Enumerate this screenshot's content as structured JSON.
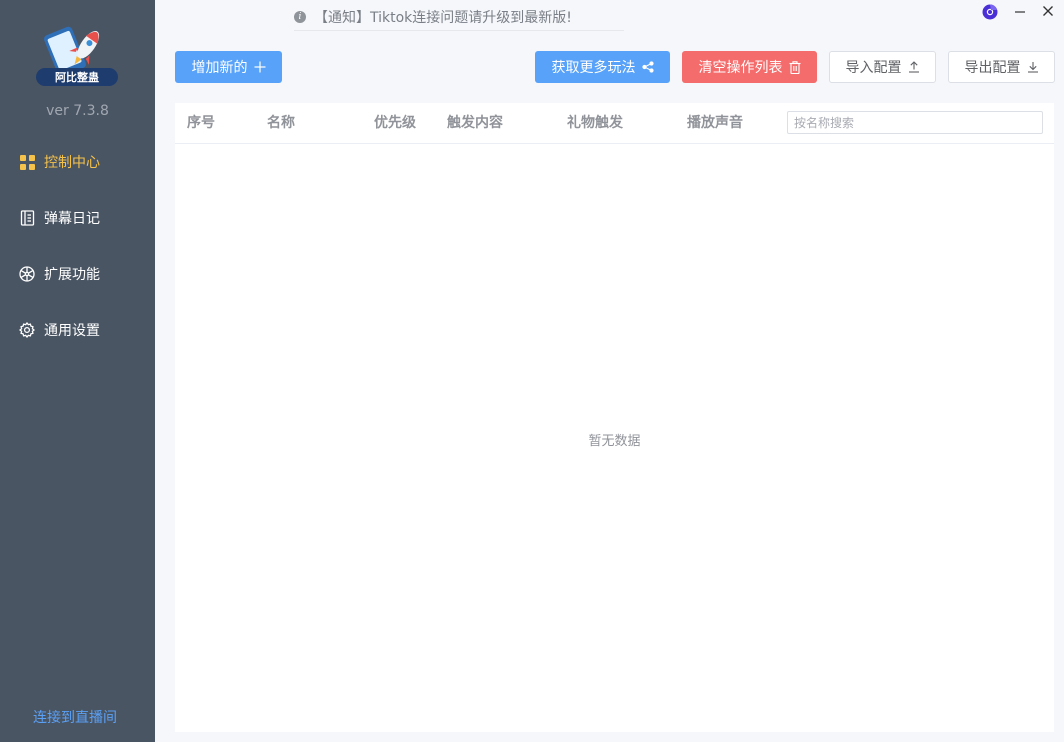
{
  "sidebar": {
    "logo_text": "阿比整蛊",
    "version": "ver 7.3.8",
    "items": [
      {
        "label": "控制中心",
        "icon": "grid-icon",
        "active": true
      },
      {
        "label": "弹幕日记",
        "icon": "notebook-icon",
        "active": false
      },
      {
        "label": "扩展功能",
        "icon": "wheel-icon",
        "active": false
      },
      {
        "label": "通用设置",
        "icon": "gear-icon",
        "active": false
      }
    ],
    "connect_label": "连接到直播间"
  },
  "notice": {
    "text": "【通知】Tiktok连接问题请升级到最新版!"
  },
  "toolbar": {
    "add_label": "增加新的",
    "more_label": "获取更多玩法",
    "clear_label": "清空操作列表",
    "import_label": "导入配置",
    "export_label": "导出配置"
  },
  "table": {
    "columns": [
      "序号",
      "名称",
      "优先级",
      "触发内容",
      "礼物触发",
      "播放声音"
    ],
    "search_placeholder": "按名称搜索",
    "empty_text": "暂无数据",
    "rows": []
  },
  "colors": {
    "sidebar_bg": "#4a5563",
    "active_nav": "#f5c24b",
    "primary": "#58a2f9",
    "danger": "#f56c6c",
    "link": "#5aa0f5"
  }
}
